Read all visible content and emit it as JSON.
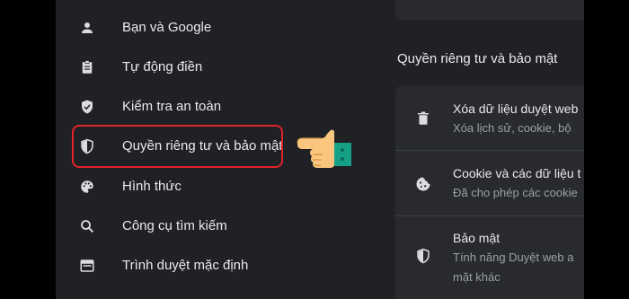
{
  "sidebar": {
    "items": [
      {
        "label": "Bạn và Google",
        "icon": "person-icon"
      },
      {
        "label": "Tự động điền",
        "icon": "clipboard-icon"
      },
      {
        "label": "Kiểm tra an toàn",
        "icon": "shield-check-icon"
      },
      {
        "label": "Quyền riêng tư và bảo mật",
        "icon": "shield-half-icon"
      },
      {
        "label": "Hình thức",
        "icon": "palette-icon"
      },
      {
        "label": "Công cụ tìm kiếm",
        "icon": "search-icon"
      },
      {
        "label": "Trình duyệt mặc định",
        "icon": "browser-window-icon"
      }
    ],
    "highlight_color": "#e0232a"
  },
  "main": {
    "section_title": "Quyền riêng tư và bảo mật",
    "rows": [
      {
        "title": "Xóa dữ liệu duyệt web",
        "subtitle": "Xóa lịch sử, cookie, bộ",
        "icon": "trash-icon"
      },
      {
        "title": "Cookie và các dữ liệu t",
        "subtitle": "Đã cho phép các cookie",
        "icon": "cookie-icon"
      },
      {
        "title": "Bảo mật",
        "subtitle": "Tính năng Duyệt web a",
        "subtitle2": "mặt khác",
        "icon": "shield-half-icon"
      }
    ]
  },
  "colors": {
    "page_bg": "#202124",
    "card_bg": "#292a2d",
    "text": "#e8eaed",
    "muted_text": "#9aa0a6",
    "icon": "#dadce0"
  }
}
